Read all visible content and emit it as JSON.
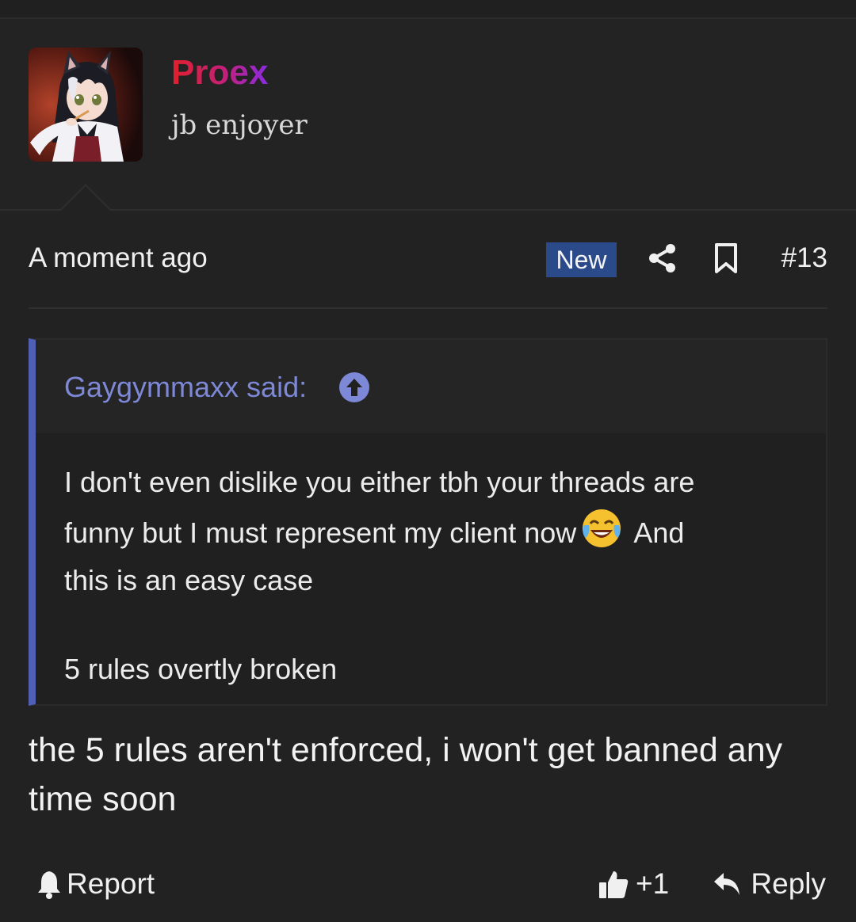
{
  "post": {
    "author": {
      "name": "Proex",
      "title": "jb enjoyer",
      "avatar_icon": "anime-catgirl-avatar"
    },
    "meta": {
      "timestamp": "A moment ago",
      "badge": "New",
      "post_number": "#13",
      "icons": [
        "share-icon",
        "bookmark-icon"
      ]
    },
    "quote": {
      "author_label": "Gaygymmaxx said:",
      "jump_icon": "arrow-up-circle-icon",
      "lines": [
        "I don't even dislike you either tbh your threads are",
        "funny but I must represent my client now",
        "And",
        "this is an easy case",
        "5 rules overtly broken"
      ],
      "emoji": "face-with-tears-of-joy"
    },
    "message_lines": [
      "the 5 rules aren't enforced, i won't get banned any",
      "time soon"
    ],
    "actions": {
      "report": "Report",
      "like_count": "+1",
      "reply": "Reply"
    }
  },
  "colors": {
    "background": "#222222",
    "quote_border": "#4f5fb6",
    "quote_author": "#7d88d6",
    "badge_bg": "#2b4a8a",
    "username_gradient": [
      "#e0202a",
      "#8a2be2"
    ]
  }
}
